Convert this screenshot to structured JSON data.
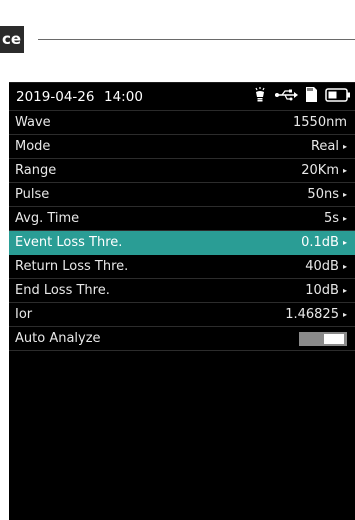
{
  "header": {
    "tag_text": "ce"
  },
  "status": {
    "date": "2019-04-26",
    "time": "14:00",
    "icons": [
      "lightbulb-icon",
      "usb-icon",
      "sd-card-icon",
      "battery-icon"
    ]
  },
  "settings": [
    {
      "label": "Wave",
      "value": "1550nm",
      "arrow": ""
    },
    {
      "label": "Mode",
      "value": "Real",
      "arrow": "▸"
    },
    {
      "label": "Range",
      "value": "20Km",
      "arrow": "▸"
    },
    {
      "label": "Pulse",
      "value": "50ns",
      "arrow": "▸"
    },
    {
      "label": "Avg. Time",
      "value": "5s",
      "arrow": "▸"
    },
    {
      "label": "Event Loss Thre.",
      "value": "0.1dB",
      "arrow": "▸"
    },
    {
      "label": "Return Loss Thre.",
      "value": "40dB",
      "arrow": "▸"
    },
    {
      "label": "End Loss Thre.",
      "value": "10dB",
      "arrow": "▸"
    },
    {
      "label": "Ior",
      "value": "1.46825",
      "arrow": "▸"
    },
    {
      "label": "Auto Analyze",
      "toggle_on": true
    }
  ],
  "colors": {
    "selected_bg": "#2a9d95",
    "screen_bg": "#000000"
  },
  "selected_label": "Event Loss Thre."
}
